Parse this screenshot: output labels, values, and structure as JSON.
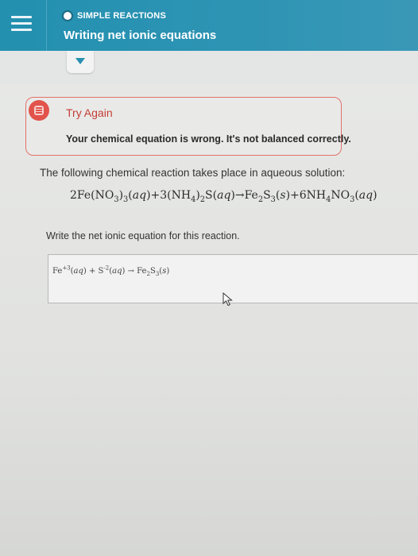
{
  "header": {
    "topic": "SIMPLE REACTIONS",
    "title": "Writing net ionic equations"
  },
  "alert": {
    "title": "Try Again",
    "message": "Your chemical equation is wrong. It's not balanced correctly."
  },
  "question": {
    "intro": "The following chemical reaction takes place in aqueous solution:",
    "equation": "2Fe(NO3)3(aq)+3(NH4)2S(aq)→Fe2S3(s)+6NH4NO3(aq)",
    "instruction": "Write the net ionic equation for this reaction."
  },
  "answer": {
    "value": "Fe+3(aq) + S-2(aq) → Fe2S3(s)"
  },
  "colors": {
    "header": "#2390b0",
    "alert_border": "#e2706a",
    "alert_icon": "#e2534b"
  }
}
